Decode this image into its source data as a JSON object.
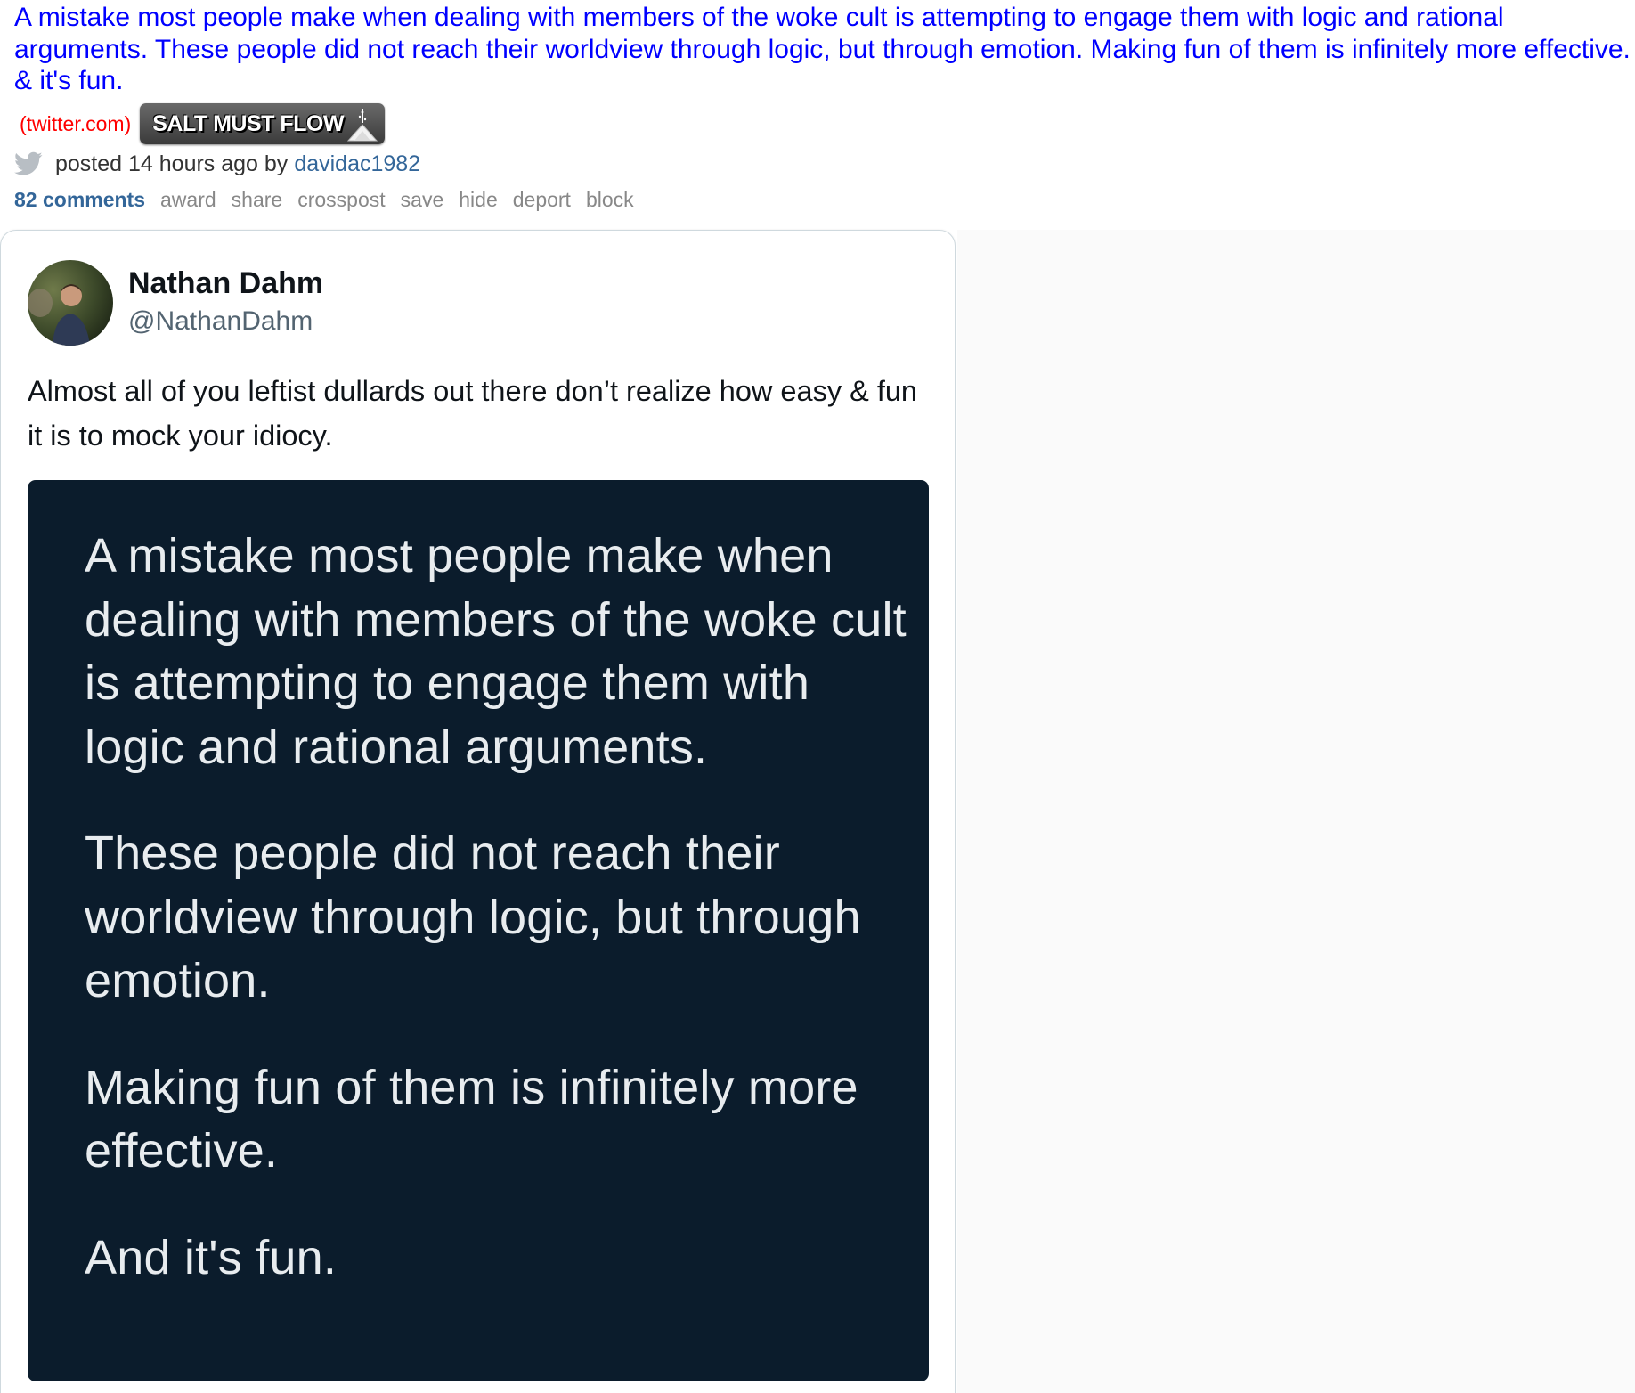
{
  "post": {
    "title": "A mistake most people make when dealing with members of the woke cult is attempting to engage them with logic and rational arguments. These people did not reach their worldview through logic, but through emotion. Making fun of them is infinitely more effective. & it's fun.",
    "domain": "(twitter.com)",
    "flair": "SALT MUST FLOW",
    "meta_prefix": "posted 14 hours ago by",
    "author": "davidac1982",
    "actions": {
      "comments": "82 comments",
      "award": "award",
      "share": "share",
      "crosspost": "crosspost",
      "save": "save",
      "hide": "hide",
      "deport": "deport",
      "block": "block"
    }
  },
  "tweet": {
    "name": "Nathan Dahm",
    "handle": "@NathanDahm",
    "text": "Almost all of you leftist dullards out there don’t realize how easy & fun it is to mock your idiocy.",
    "image_paragraphs": [
      "A mistake most people make when dealing with members of the woke cult is attempting to engage them with logic and rational arguments.",
      "These people did not reach their worldview through logic, but through emotion.",
      "Making fun of them is infinitely more effective.",
      "And it's fun."
    ]
  },
  "icons": {
    "twitter": "twitter-bird-icon",
    "flair": "salt-pile-icon",
    "avatar": "avatar"
  },
  "colors": {
    "title_link": "#0000ff",
    "domain": "#ff0000",
    "author": "#336699",
    "action": "#888888",
    "image_bg": "#0b1c2c"
  }
}
